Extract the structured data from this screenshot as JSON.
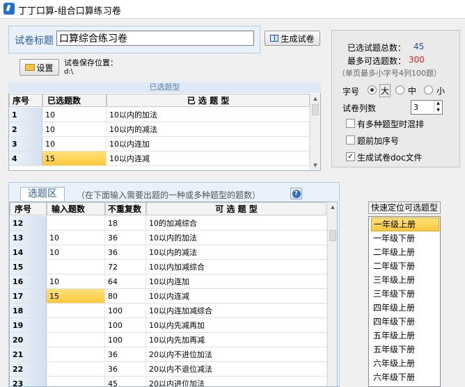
{
  "window": {
    "title": "丁丁口算-组合口算练习卷"
  },
  "paper": {
    "title_label": "试卷标题",
    "title_value": "口算综合练习卷",
    "generate_label": "生成试卷",
    "settings_label": "设置",
    "save_path_label": "试卷保存位置：",
    "save_path_value": "d:\\"
  },
  "selected": {
    "caption": "已选题型",
    "headers": [
      "序号",
      "已选题数",
      "已 选 题 型"
    ],
    "rows": [
      {
        "no": "1",
        "count": "10",
        "type": "10以内的加法"
      },
      {
        "no": "2",
        "count": "10",
        "type": "10以内的减法"
      },
      {
        "no": "3",
        "count": "10",
        "type": "10以内连加"
      },
      {
        "no": "4",
        "count": "15",
        "type": "10以内连减"
      }
    ]
  },
  "stats": {
    "total_label": "已选试题总数：",
    "total_value": "45",
    "max_label": "最多可选题数：",
    "max_value": "300",
    "note": "（单页最多小字号4列100题）"
  },
  "font_size": {
    "label": "字号",
    "options": [
      "大",
      "中",
      "小"
    ],
    "selected": "大"
  },
  "columns": {
    "label": "试卷列数",
    "value": "3"
  },
  "options": [
    {
      "label": "有多种题型时混排",
      "checked": false
    },
    {
      "label": "题前加序号",
      "checked": false
    },
    {
      "label": "生成试卷doc文件",
      "checked": true
    }
  ],
  "pick": {
    "tab_label": "选题区",
    "hint": "（在下面输入需要出题的一种或多种题型的题数）",
    "headers": [
      "序号",
      "输入题数",
      "不重复数",
      "可 选 题 型"
    ],
    "rows": [
      {
        "no": "12",
        "input": "",
        "unique": "18",
        "type": "10的加减综合"
      },
      {
        "no": "13",
        "input": "10",
        "unique": "36",
        "type": "10以内的加法"
      },
      {
        "no": "14",
        "input": "10",
        "unique": "36",
        "type": "10以内的减法"
      },
      {
        "no": "15",
        "input": "",
        "unique": "72",
        "type": "10以内加减综合"
      },
      {
        "no": "16",
        "input": "10",
        "unique": "64",
        "type": "10以内连加"
      },
      {
        "no": "17",
        "input": "15",
        "unique": "80",
        "type": "10以内连减"
      },
      {
        "no": "18",
        "input": "",
        "unique": "100",
        "type": "10以内连加减综合"
      },
      {
        "no": "19",
        "input": "",
        "unique": "100",
        "type": "10以内先减再加"
      },
      {
        "no": "20",
        "input": "",
        "unique": "100",
        "type": "10以内先加再减"
      },
      {
        "no": "21",
        "input": "",
        "unique": "36",
        "type": "20以内不进位加法"
      },
      {
        "no": "22",
        "input": "",
        "unique": "36",
        "type": "20以内不退位减法"
      },
      {
        "no": "23",
        "input": "",
        "unique": "45",
        "type": "20以内进位加法"
      }
    ]
  },
  "locate": {
    "label": "快速定位可选题型",
    "items": [
      "一年级上册",
      "一年级下册",
      "二年级上册",
      "二年级下册",
      "三年级上册",
      "三年级下册",
      "四年级上册",
      "四年级下册",
      "五年级上册",
      "五年级下册",
      "六年级上册",
      "六年级下册"
    ],
    "selected_index": 0
  }
}
